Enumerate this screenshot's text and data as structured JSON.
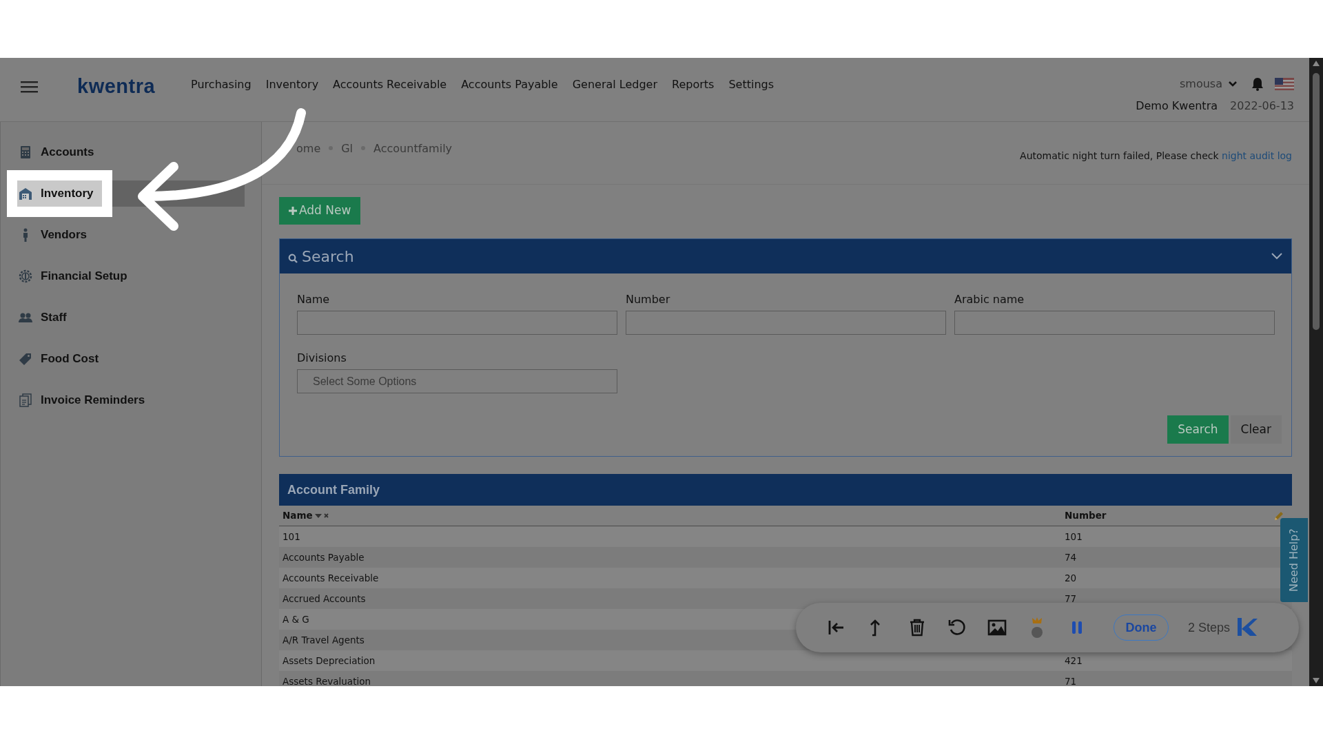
{
  "header": {
    "logo": "kwentra",
    "menu": [
      "Purchasing",
      "Inventory",
      "Accounts Receivable",
      "Accounts Payable",
      "General Ledger",
      "Reports",
      "Settings"
    ],
    "user": "smousa",
    "company": "Demo Kwentra",
    "date": "2022-06-13"
  },
  "sidebar": {
    "items": [
      {
        "label": "Accounts",
        "selected": false
      },
      {
        "label": "Inventory",
        "selected": true
      },
      {
        "label": "Vendors",
        "selected": false
      },
      {
        "label": "Financial Setup",
        "selected": false
      },
      {
        "label": "Staff",
        "selected": false
      },
      {
        "label": "Food Cost",
        "selected": false
      },
      {
        "label": "Invoice Reminders",
        "selected": false
      }
    ]
  },
  "breadcrumb": [
    "ome",
    "Gl",
    "Accountfamily"
  ],
  "notice": {
    "text": "Automatic night turn failed, Please check",
    "link": "night audit log"
  },
  "add_button": "Add New",
  "search_panel": {
    "title": "Search",
    "fields": [
      {
        "label": "Name"
      },
      {
        "label": "Number"
      },
      {
        "label": "Arabic name"
      },
      {
        "label": "Divisions",
        "placeholder": "Select Some Options"
      }
    ],
    "buttons": [
      "Search",
      "Clear"
    ]
  },
  "table": {
    "title": "Account Family",
    "columns": [
      "Name",
      "Number"
    ],
    "rows": [
      {
        "name": "101",
        "number": "101"
      },
      {
        "name": "Accounts Payable",
        "number": "74"
      },
      {
        "name": "Accounts Receivable",
        "number": "20"
      },
      {
        "name": "Accrued Accounts",
        "number": "77"
      },
      {
        "name": "A & G"
      },
      {
        "name": "A/R Travel Agents"
      },
      {
        "name": "Assets Depreciation",
        "number": "421"
      },
      {
        "name": "Assets Revaluation",
        "number": "71"
      }
    ]
  },
  "help_tab": "Need Help?",
  "recorder": {
    "done": "Done",
    "steps": "2 Steps"
  }
}
